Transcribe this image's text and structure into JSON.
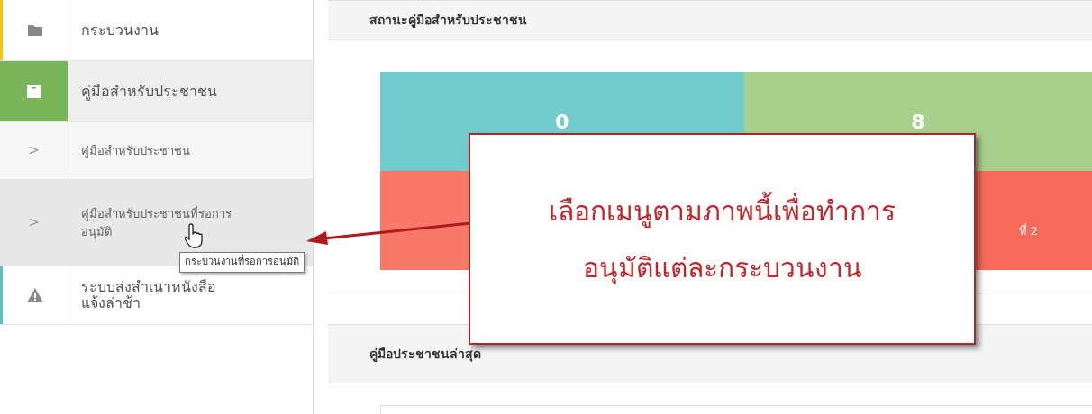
{
  "sidebar": {
    "items": [
      {
        "kind": "menu",
        "label": "กระบวนงาน",
        "color": "#f0c419",
        "expanded": false
      },
      {
        "kind": "menu",
        "label": "คู่มือสำหรับประชาชน",
        "color": "#7ab55c",
        "expanded": true,
        "children": [
          {
            "chevron": ">",
            "label": "คู่มือสำหรับประชาชน",
            "hovered": false
          },
          {
            "chevron": ">",
            "label": "คู่มือสำหรับประชาชนที่รอการอนุมัติ",
            "hovered": true,
            "tooltip": "กระบวนงานที่รอการอนุมัติ"
          }
        ]
      },
      {
        "kind": "menu",
        "label": "ระบบส่งสำเนาหนังสือแจ้งล่าช้า",
        "color": "#5bc0c4",
        "expanded": false
      }
    ]
  },
  "panels": [
    {
      "title": "สถานะคู่มือสำหรับประชาชน",
      "tiles": [
        {
          "value": "0",
          "color": "#72cccc"
        },
        {
          "value": "8",
          "color": "#a8d08c"
        },
        {
          "color": "#f8786a"
        },
        {
          "label": "ที่ 2",
          "color": "#f76a5a"
        }
      ]
    },
    {
      "title": "คู่มือประชาชนล่าสุด"
    }
  ],
  "callout": {
    "lines": [
      "เลือกเมนูตามภาพนี้เพื่อทำการ",
      "อนุมัติแต่ละกระบวนงาน"
    ]
  }
}
